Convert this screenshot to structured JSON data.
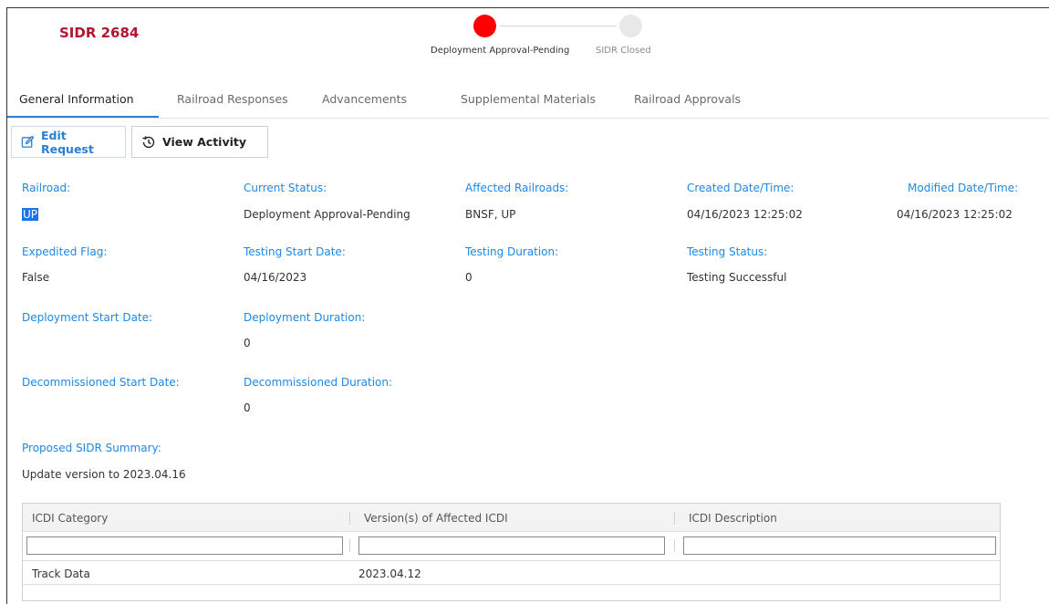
{
  "header": {
    "title": "SIDR 2684"
  },
  "stepper": {
    "steps": [
      {
        "label": "Deployment Approval-Pending",
        "state": "active",
        "color": "#ff0000"
      },
      {
        "label": "SIDR Closed",
        "state": "inactive",
        "color": "#e8e8e8"
      }
    ]
  },
  "tabs": [
    {
      "label": "General Information",
      "active": true
    },
    {
      "label": "Railroad Responses",
      "active": false
    },
    {
      "label": "Advancements",
      "active": false
    },
    {
      "label": "Supplemental Materials",
      "active": false
    },
    {
      "label": "Railroad Approvals",
      "active": false
    }
  ],
  "toolbar": {
    "edit_label": "Edit Request",
    "view_label": "View Activity"
  },
  "fields": {
    "railroad": {
      "label": "Railroad:",
      "value": "UP"
    },
    "current_status": {
      "label": "Current Status:",
      "value": "Deployment Approval-Pending"
    },
    "affected_railroads": {
      "label": "Affected Railroads:",
      "value": "BNSF, UP"
    },
    "created": {
      "label": "Created Date/Time:",
      "value": "04/16/2023 12:25:02"
    },
    "modified": {
      "label": "Modified Date/Time:",
      "value": "04/16/2023 12:25:02"
    },
    "expedited": {
      "label": "Expedited Flag:",
      "value": "False"
    },
    "testing_start": {
      "label": "Testing Start Date:",
      "value": "04/16/2023"
    },
    "testing_duration": {
      "label": "Testing Duration:",
      "value": "0"
    },
    "testing_status": {
      "label": "Testing Status:",
      "value": "Testing Successful"
    },
    "deployment_start": {
      "label": "Deployment Start Date:",
      "value": ""
    },
    "deployment_duration": {
      "label": "Deployment Duration:",
      "value": "0"
    },
    "decommissioned_start": {
      "label": "Decommissioned Start Date:",
      "value": ""
    },
    "decommissioned_duration": {
      "label": "Decommissioned Duration:",
      "value": "0"
    },
    "summary": {
      "label": "Proposed SIDR Summary:",
      "value": "Update version to 2023.04.16"
    }
  },
  "table": {
    "columns": [
      "ICDI Category",
      "Version(s) of Affected ICDI",
      "ICDI Description"
    ],
    "filters": [
      "",
      "",
      ""
    ],
    "rows": [
      [
        "Track Data",
        "2023.04.12",
        ""
      ]
    ]
  },
  "colors": {
    "title": "#b0162f",
    "label": "#1e88e5",
    "accent": "#2f7fd8"
  }
}
